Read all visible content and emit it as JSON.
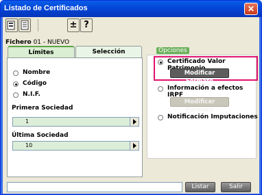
{
  "window": {
    "title": "Listado de Certificados",
    "close_symbol": "✕"
  },
  "toolbar": {
    "buttons": [
      {
        "name": "print-preview-icon"
      },
      {
        "name": "list-document-icon"
      },
      {
        "name": "plus-minus-icon",
        "symbol": "±"
      },
      {
        "name": "help-icon",
        "symbol": "?"
      }
    ]
  },
  "fichero": {
    "label": "Fichero",
    "value": "01 - NUEVO"
  },
  "tabs": [
    {
      "label": "Límites",
      "selected": true
    },
    {
      "label": "Selección",
      "selected": false
    }
  ],
  "sort_options": [
    {
      "label": "Nombre",
      "selected": false
    },
    {
      "label": "Código",
      "selected": true
    },
    {
      "label": "N.I.F.",
      "selected": false
    }
  ],
  "primera_sociedad": {
    "label": "Primera Sociedad",
    "value": "1"
  },
  "ultima_sociedad": {
    "label": "Última Sociedad",
    "value": "10"
  },
  "opciones": {
    "title": "Opciones",
    "items": [
      {
        "label": "Certificado Valor Patrimonio",
        "selected": true,
        "button": "Modificar Formato",
        "button_enabled": true
      },
      {
        "label": "Información a efectos IRPF",
        "selected": false,
        "button": "Modificar Formato",
        "button_enabled": false
      },
      {
        "label": "Notificación Imputaciones",
        "selected": false
      }
    ]
  },
  "status": {
    "field_value": ""
  },
  "actions": {
    "listar": "Listar",
    "salir": "Salir"
  },
  "colors": {
    "highlight": "#e0116e",
    "tab_green": "#6ab05a"
  }
}
